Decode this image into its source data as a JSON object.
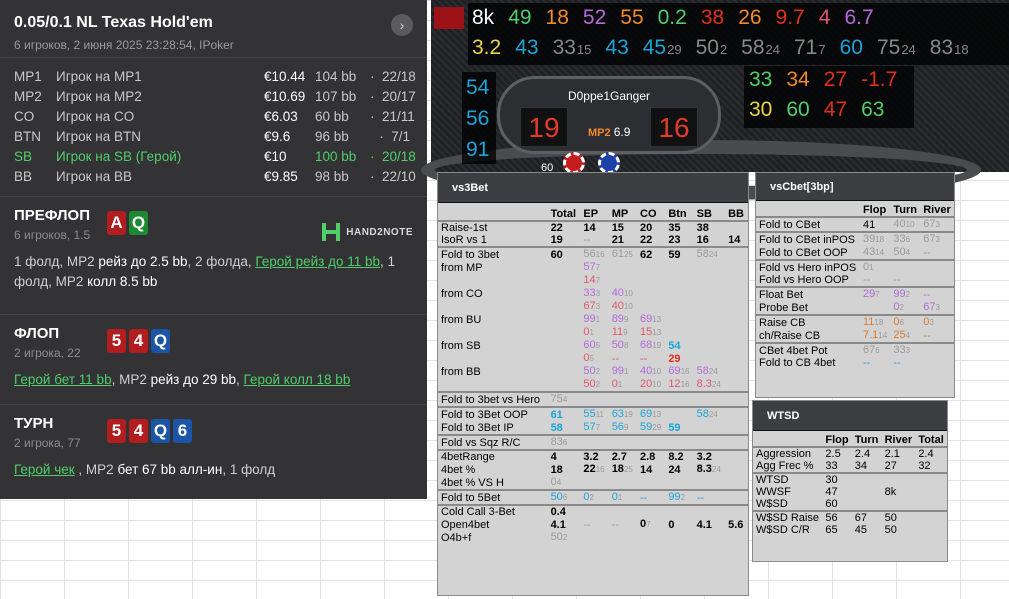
{
  "hand": {
    "title": "0.05/0.1 NL Texas Hold'em",
    "subtitle": "6 игроков, 2 июня 2025 23:28:54, IPoker",
    "more_glyph": "›"
  },
  "players": [
    {
      "pos": "MP1",
      "name": "Игрок на MP1",
      "stack": "€10.44",
      "bb": "104 bb",
      "sep": "·",
      "stats": "22/18",
      "hero": false
    },
    {
      "pos": "MP2",
      "name": "Игрок на MP2",
      "stack": "€10.69",
      "bb": "107 bb",
      "sep": "·",
      "stats": "20/17",
      "hero": false
    },
    {
      "pos": "CO",
      "name": "Игрок на CO",
      "stack": "€6.03",
      "bb": "60 bb",
      "sep": "·",
      "stats": "21/11",
      "hero": false
    },
    {
      "pos": "BTN",
      "name": "Игрок на BTN",
      "stack": "€9.6",
      "bb": "96 bb",
      "sep": "·",
      "stats": "7/1",
      "hero": false
    },
    {
      "pos": "SB",
      "name": "Игрок на SB (Герой)",
      "stack": "€10",
      "bb": "100 bb",
      "sep": "·",
      "stats": "20/18",
      "hero": true
    },
    {
      "pos": "BB",
      "name": "Игрок на BB",
      "stack": "€9.85",
      "bb": "98 bb",
      "sep": "·",
      "stats": "22/10",
      "hero": false
    }
  ],
  "preflop": {
    "title": "ПРЕФЛОП",
    "sub": "6 игроков, 1.5",
    "cards": [
      {
        "v": "A",
        "c": "red"
      },
      {
        "v": "Q",
        "c": "green"
      }
    ],
    "brand": "HAND2NOTE",
    "a1": "1 фолд, MP2 ",
    "a2": "рейз до 2.5 bb",
    "a3": ", 2 фолда, ",
    "a4": "Герой рейз до 11 bb",
    "a5": ", 1 фолд, MP2 ",
    "a6": "колл 8.5 bb"
  },
  "flop": {
    "title": "ФЛОП",
    "sub": "2 игрока, 22",
    "cards": [
      {
        "v": "5",
        "c": "red"
      },
      {
        "v": "4",
        "c": "red"
      },
      {
        "v": "Q",
        "c": "blue"
      }
    ],
    "a1": "Герой бет 11 bb",
    "a2": ", MP2 ",
    "a3": "рейз до 29 bb",
    "a4": ", ",
    "a5": "Герой колл 18 bb"
  },
  "turn": {
    "title": "ТУРН",
    "sub": "2 игрока, 77",
    "cards": [
      {
        "v": "5",
        "c": "red"
      },
      {
        "v": "4",
        "c": "red"
      },
      {
        "v": "Q",
        "c": "blue"
      },
      {
        "v": "6",
        "c": "blue"
      }
    ],
    "a1": "Герой чек",
    "a2": " , MP2 ",
    "a3": "бет 67 bb алл-ин",
    "a4": ", 1 фолд"
  },
  "hud": {
    "row1": [
      {
        "t": "8k",
        "c": "#ffffff"
      },
      {
        "t": "49",
        "c": "#4fce6a"
      },
      {
        "t": "18",
        "c": "#f08a2b"
      },
      {
        "t": "52",
        "c": "#b46ad9"
      },
      {
        "t": "55",
        "c": "#f08a2b"
      },
      {
        "t": "0.2",
        "c": "#4fce6a"
      },
      {
        "t": "38",
        "c": "#e0301e"
      },
      {
        "t": "26",
        "c": "#f08a2b"
      },
      {
        "t": "9.7",
        "c": "#e0301e"
      },
      {
        "t": "4",
        "c": "#e2556e"
      },
      {
        "t": "6.7",
        "c": "#b46ad9"
      }
    ],
    "row2": [
      {
        "t": "3.2",
        "s": "",
        "c": "#e8d54a"
      },
      {
        "t": "43",
        "s": "",
        "c": "#1aa5d8"
      },
      {
        "t": "33",
        "s": "15",
        "c": "#888"
      },
      {
        "t": "43",
        "s": "",
        "c": "#1aa5d8"
      },
      {
        "t": "45",
        "s": "29",
        "c": "#1aa5d8"
      },
      {
        "t": "50",
        "s": "2",
        "c": "#888"
      },
      {
        "t": "58",
        "s": "24",
        "c": "#888"
      },
      {
        "t": "71",
        "s": "7",
        "c": "#888"
      },
      {
        "t": "60",
        "s": "",
        "c": "#1aa5d8"
      },
      {
        "t": "75",
        "s": "24",
        "c": "#888"
      },
      {
        "t": "83",
        "s": "18",
        "c": "#888"
      }
    ],
    "left_col": [
      "54",
      "56",
      "91"
    ],
    "right_r1": [
      {
        "t": "33",
        "c": "#4fce6a"
      },
      {
        "t": "34",
        "c": "#f08a2b"
      },
      {
        "t": "27",
        "c": "#e0301e"
      },
      {
        "t": "-1.7",
        "c": "#e0301e"
      }
    ],
    "right_r2": [
      {
        "t": "30",
        "c": "#e8d54a"
      },
      {
        "t": "60",
        "c": "#4fce6a"
      },
      {
        "t": "47",
        "c": "#e0301e"
      },
      {
        "t": "63",
        "c": "#4fce6a"
      }
    ],
    "player_name": "D0ppe1Ganger",
    "left_box": "19",
    "right_box": "16",
    "pos_label": "MP2",
    "pos_value": "6.9",
    "partial_num": "60"
  },
  "vs3bet": {
    "title": "vs3Bet",
    "headers": [
      "",
      "Total",
      "EP",
      "MP",
      "CO",
      "Btn",
      "SB",
      "BB"
    ],
    "rows": [
      {
        "sep": true,
        "label": "Raise-1st",
        "cells": [
          "22",
          "14",
          "15",
          "20",
          "35",
          "38",
          ""
        ]
      },
      {
        "label": "IsoR vs 1",
        "cells": [
          "19",
          "--",
          "21",
          "22",
          "23",
          "16",
          "14"
        ]
      },
      {
        "sep": true,
        "label": "Fold to 3bet",
        "cells": [
          "60",
          "56|16",
          "61|25",
          "62",
          "59",
          "58|24",
          ""
        ]
      },
      {
        "label": "from MP",
        "cells": [
          "",
          "57|7",
          "",
          "",
          "",
          "",
          ""
        ]
      },
      {
        "label": "",
        "cells": [
          "",
          "14|7",
          "",
          "",
          "",
          "",
          ""
        ]
      },
      {
        "label": "from CO",
        "cells": [
          "",
          "33|3",
          "40|10",
          "",
          "",
          "",
          ""
        ]
      },
      {
        "label": "",
        "cells": [
          "",
          "67|3",
          "40|10",
          "",
          "",
          "",
          ""
        ]
      },
      {
        "label": "from BU",
        "cells": [
          "",
          "99|1",
          "89|9",
          "69|13",
          "",
          "",
          ""
        ]
      },
      {
        "label": "",
        "cells": [
          "",
          "0|1",
          "11|9",
          "15|13",
          "",
          "",
          ""
        ]
      },
      {
        "label": "from SB",
        "cells": [
          "",
          "60|5",
          "50|8",
          "68|19",
          "54",
          "",
          ""
        ]
      },
      {
        "label": "",
        "cells": [
          "",
          "0|5",
          "--",
          "--",
          "29",
          "",
          ""
        ]
      },
      {
        "label": "from BB",
        "cells": [
          "",
          "50|2",
          "99|1",
          "40|10",
          "69|16",
          "58|24",
          ""
        ]
      },
      {
        "label": "",
        "cells": [
          "",
          "50|2",
          "0|1",
          "20|10",
          "12|16",
          "8.3|24",
          ""
        ]
      },
      {
        "sep": true,
        "label": "Fold to 3bet vs Hero",
        "cells": [
          "75|4",
          "",
          "",
          "",
          "",
          "",
          ""
        ]
      },
      {
        "sep": true,
        "label": "Fold to 3Bet OOP",
        "cells": [
          "61",
          "55|11",
          "63|19",
          "69|13",
          "",
          "58|24",
          ""
        ]
      },
      {
        "label": "Fold to 3Bet IP",
        "cells": [
          "58",
          "57|7",
          "56|9",
          "59|29",
          "59",
          "",
          ""
        ]
      },
      {
        "sep": true,
        "label": "Fold vs Sqz R/C",
        "cells": [
          "83|6",
          "",
          "",
          "",
          "",
          "",
          ""
        ]
      },
      {
        "sep": true,
        "label": "4betRange",
        "cells": [
          "4",
          "3.2",
          "2.7",
          "2.8",
          "8.2",
          "3.2",
          ""
        ]
      },
      {
        "label": "4bet %",
        "cells": [
          "18",
          "22|16",
          "18|25",
          "14",
          "24",
          "8.3|24",
          ""
        ]
      },
      {
        "label": "4bet % VS H",
        "cells": [
          "0|4",
          "",
          "",
          "",
          "",
          "",
          ""
        ]
      },
      {
        "sep": true,
        "label": "Fold to 5Bet",
        "cells": [
          "50|6",
          "0|2",
          "0|1",
          "--",
          "99|2",
          "--",
          ""
        ]
      },
      {
        "sep": true,
        "label": "Cold Call 3-Bet",
        "cells": [
          "0.4",
          "",
          "",
          "",
          "",
          "",
          ""
        ]
      },
      {
        "label": "Open4bet",
        "cells": [
          "4.1",
          "--",
          "--",
          "0|7",
          "0",
          "4.1",
          "5.6"
        ]
      },
      {
        "label": "O4b+f",
        "cells": [
          "50|2",
          "",
          "",
          "",
          "",
          "",
          ""
        ]
      }
    ]
  },
  "vscbet": {
    "title": "vsCbet[3bp]",
    "headers": [
      "",
      "Flop",
      "Turn",
      "River"
    ],
    "rows": [
      {
        "sep": true,
        "label": "Fold to CBet",
        "cells": [
          "41",
          "40|10",
          "67|3"
        ]
      },
      {
        "sep": true,
        "label": "Fold to CBet inPOS",
        "cells": [
          "39|18",
          "33|6",
          "67|3"
        ]
      },
      {
        "label": "Fold to CBet OOP",
        "cells": [
          "43|14",
          "50|4",
          "--"
        ]
      },
      {
        "sep": true,
        "label": "Fold vs Hero inPOS",
        "cells": [
          "0|1",
          "",
          ""
        ]
      },
      {
        "label": "Fold vs Hero OOP",
        "cells": [
          "--",
          "--",
          ""
        ]
      },
      {
        "sep": true,
        "label": "Float Bet",
        "cells": [
          "29|7",
          "99|2",
          "--"
        ]
      },
      {
        "label": "Probe Bet",
        "cells": [
          "",
          "0|2",
          "67|3"
        ]
      },
      {
        "sep": true,
        "label": "Raise CB",
        "cells": [
          "11|18",
          "0|6",
          "0|3"
        ]
      },
      {
        "label": "ch/Raise CB",
        "cells": [
          "7.1|14",
          "25|4",
          "--"
        ]
      },
      {
        "sep": true,
        "label": "CBet 4bet Pot",
        "cells": [
          "67|6",
          "33|3",
          ""
        ]
      },
      {
        "label": "Fold to CB 4bet",
        "cells": [
          "--",
          "--",
          ""
        ]
      }
    ]
  },
  "wtsd": {
    "title": "WTSD",
    "headers": [
      "",
      "Flop",
      "Turn",
      "River",
      "Total"
    ],
    "rows": [
      {
        "sep": true,
        "label": "Aggression",
        "cells": [
          "2.5",
          "2.4",
          "2.1",
          "2.4"
        ]
      },
      {
        "label": "Agg Frec %",
        "cells": [
          "33",
          "34",
          "27",
          "32"
        ]
      },
      {
        "sep": true,
        "label": "WTSD",
        "cells": [
          "30",
          "",
          "",
          ""
        ]
      },
      {
        "label": "WWSF",
        "cells": [
          "47",
          "",
          "8k",
          ""
        ]
      },
      {
        "label": "W$SD",
        "cells": [
          "60",
          "",
          "",
          ""
        ]
      },
      {
        "sep": true,
        "label": "W$SD Raise",
        "cells": [
          "56",
          "67",
          "50",
          ""
        ]
      },
      {
        "label": "W$SD C/R",
        "cells": [
          "65",
          "45",
          "50",
          ""
        ]
      }
    ]
  },
  "colors": {
    "hero_green": "#4fce6a",
    "card_red": "#b21d1f",
    "card_green": "#1d8a32",
    "card_blue": "#1c55a8",
    "panel_bg": "#d3d3d3"
  }
}
